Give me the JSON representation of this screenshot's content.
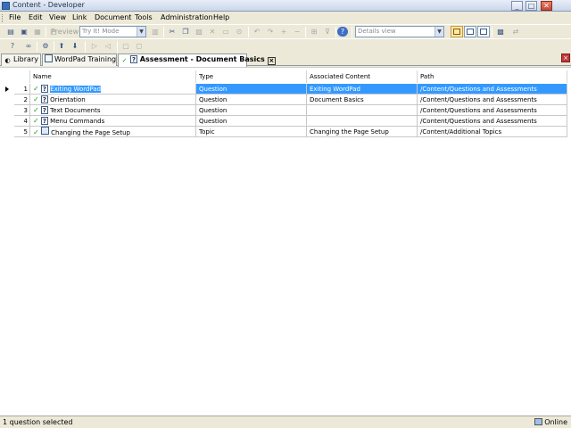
{
  "window": {
    "title": "Content - Developer"
  },
  "menu": [
    "File",
    "Edit",
    "View",
    "Link",
    "Document",
    "Tools",
    "Administration",
    "Help"
  ],
  "toolbar": {
    "preview_label": "Preview",
    "mode_value": "Try It! Mode",
    "view_value": "Details view"
  },
  "tabs": [
    {
      "label": "Library"
    },
    {
      "label": "WordPad Training"
    },
    {
      "label": "Assessment - Document Basics",
      "active": true
    }
  ],
  "grid": {
    "columns": [
      "Name",
      "Type",
      "Associated Content",
      "Path"
    ],
    "rows": [
      {
        "num": "1",
        "name": "Exiting WordPad",
        "type": "Question",
        "content": "Exiting WordPad",
        "path": "/Content/Questions and Assessments",
        "icon": "question-icon",
        "selected": true
      },
      {
        "num": "2",
        "name": "Orientation",
        "type": "Question",
        "content": "Document Basics",
        "path": "/Content/Questions and Assessments",
        "icon": "question-icon"
      },
      {
        "num": "3",
        "name": "Text Documents",
        "type": "Question",
        "content": "",
        "path": "/Content/Questions and Assessments",
        "icon": "question-icon"
      },
      {
        "num": "4",
        "name": "Menu Commands",
        "type": "Question",
        "content": "",
        "path": "/Content/Questions and Assessments",
        "icon": "question-icon"
      },
      {
        "num": "5",
        "name": "Changing the Page Setup",
        "type": "Topic",
        "content": "Changing the Page Setup",
        "path": "/Content/Additional Topics",
        "icon": "topic-icon"
      }
    ]
  },
  "status": {
    "left": "1 question selected",
    "right": "Online"
  },
  "colors": {
    "selection": "#3399ff",
    "check": "#1a9a1a",
    "chrome": "#ece9d8"
  }
}
